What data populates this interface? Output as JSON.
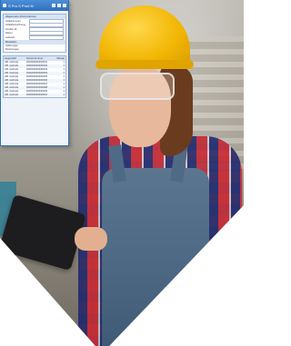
{
  "window": {
    "title": "S Pro S Prod M"
  },
  "upper_panel": {
    "header": "Allgemeine Informationen",
    "fields": [
      {
        "label": "Artikelnummer"
      },
      {
        "label": "Artikelbezeichnung"
      },
      {
        "label": "Kunden-Nr."
      },
      {
        "label": "Datum"
      },
      {
        "label": "Lieferant"
      }
    ],
    "tree_header": "Bestellen",
    "tree_items": [
      "Lieferungen",
      "Rechnungen"
    ]
  },
  "list_panel": {
    "columns": [
      "Lagerplatz",
      "Seriennummer",
      "Menge"
    ],
    "rows": [
      {
        "c1": "LB1 Gebinde",
        "c2": "0000000000000001",
        "c3": "1"
      },
      {
        "c1": "LB1 Gebinde",
        "c2": "0000000000000002",
        "c3": "1"
      },
      {
        "c1": "LB1 Gebinde",
        "c2": "0000000000000003",
        "c3": "1"
      },
      {
        "c1": "LB1 Gebinde",
        "c2": "0000000000000004",
        "c3": "1"
      },
      {
        "c1": "LB1 Gebinde",
        "c2": "0000000000000005",
        "c3": "1"
      },
      {
        "c1": "LB1 Gebinde",
        "c2": "0000000000000006",
        "c3": "1"
      },
      {
        "c1": "LB1 Gebinde",
        "c2": "0000000000000007",
        "c3": "1"
      },
      {
        "c1": "LB1 Gebinde",
        "c2": "0000000000000008",
        "c3": "1"
      },
      {
        "c1": "LB1 Gebinde",
        "c2": "0000000000000009",
        "c3": "1"
      },
      {
        "c1": "LB1 Gebinde",
        "c2": "0000000000000010",
        "c3": "1"
      }
    ]
  },
  "colors": {
    "title_bar": "#2d6fbf",
    "helmet": "#f2b705",
    "overall": "#4b6782"
  }
}
